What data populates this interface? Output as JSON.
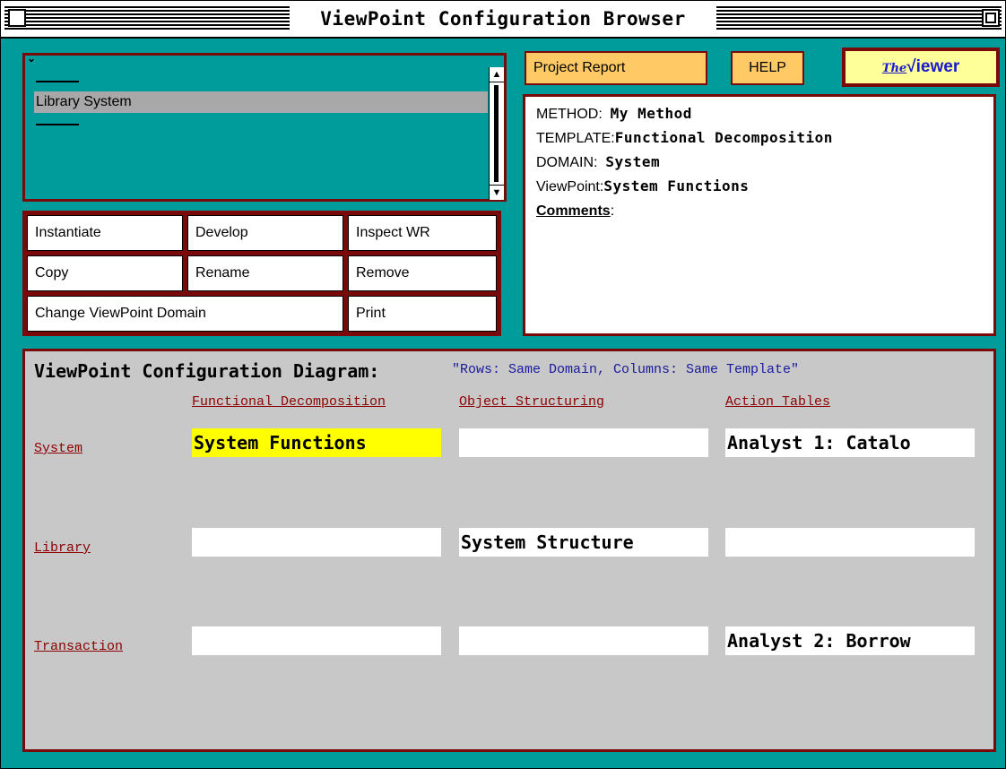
{
  "window": {
    "title": "ViewPoint Configuration Browser"
  },
  "library": {
    "items": [
      "Library System"
    ],
    "scroll_up": "▲",
    "scroll_down": "▼",
    "collapse": "⌄"
  },
  "buttons": {
    "instantiate": "Instantiate",
    "develop": "Develop",
    "inspect_wr": "Inspect WR",
    "copy": "Copy",
    "rename": "Rename",
    "remove": "Remove",
    "change_domain": "Change ViewPoint Domain",
    "print": "Print"
  },
  "top_buttons": {
    "project_report": "Project Report",
    "help": "HELP"
  },
  "viewer_logo": {
    "the": "The",
    "check": "√",
    "word": "iewer"
  },
  "info": {
    "method_label": "METHOD:",
    "method_value": "My Method",
    "template_label": "TEMPLATE:",
    "template_value": "Functional Decomposition",
    "domain_label": "DOMAIN:",
    "domain_value": "System",
    "viewpoint_label": "ViewPoint:",
    "viewpoint_value": "System Functions",
    "comments_label": "Comments",
    "comments_colon": ":"
  },
  "diagram": {
    "title": "ViewPoint Configuration Diagram:",
    "subtitle": "\"Rows: Same Domain, Columns: Same Template\"",
    "columns": [
      "Functional Decomposition",
      "Object Structuring",
      "Action Tables"
    ],
    "rows": [
      {
        "label": "System",
        "cells": [
          "System Functions",
          "",
          "Analyst 1: Catalo"
        ]
      },
      {
        "label": "Library",
        "cells": [
          "",
          "System Structure",
          ""
        ]
      },
      {
        "label": "Transaction",
        "cells": [
          "",
          "",
          "Analyst 2: Borrow"
        ]
      }
    ]
  },
  "colors": {
    "teal": "#009b9b",
    "maroon": "#7a0a0a",
    "highlight": "#ffff00",
    "button": "#ffc966",
    "viewer_bg": "#ffff99"
  }
}
